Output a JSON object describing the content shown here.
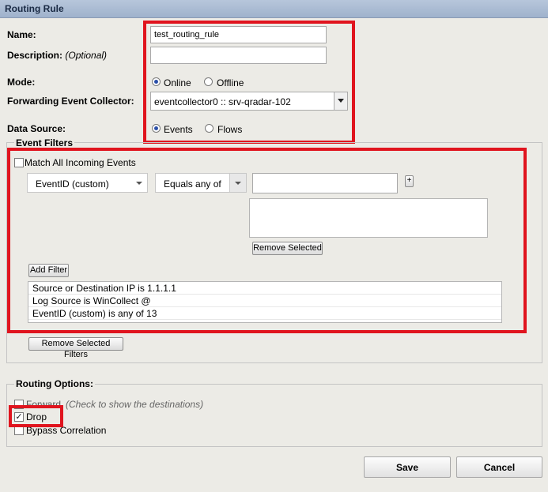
{
  "window": {
    "title": "Routing Rule"
  },
  "form": {
    "name_label": "Name:",
    "name_value": "test_routing_rule",
    "description_label": "Description:",
    "description_optional": "(Optional)",
    "description_value": "",
    "mode_label": "Mode:",
    "mode_online": "Online",
    "mode_offline": "Offline",
    "mode_selected": "Online",
    "collector_label": "Forwarding Event Collector:",
    "collector_value": "eventcollector0 :: srv-qradar-102",
    "datasource_label": "Data Source:",
    "datasource_events": "Events",
    "datasource_flows": "Flows",
    "datasource_selected": "Events"
  },
  "event_filters": {
    "legend": "Event Filters",
    "match_all_label": "Match All Incoming Events",
    "match_all_checked": false,
    "field_select": "EventID (custom)",
    "operator_select": "Equals any of",
    "value_input": "",
    "add_value_label": "+",
    "remove_selected_label": "Remove Selected",
    "add_filter_label": "Add Filter",
    "filters": [
      "Source or Destination IP is 1.1.1.1",
      "Log Source is WinCollect @",
      "EventID (custom) is any of 13"
    ],
    "remove_selected_filters_label": "Remove Selected Filters"
  },
  "routing_options": {
    "legend": "Routing Options:",
    "forward_label": "Forward",
    "forward_hint": "(Check to show the destinations)",
    "forward_checked": false,
    "drop_label": "Drop",
    "drop_checked": true,
    "bypass_label": "Bypass Correlation",
    "bypass_checked": false
  },
  "footer": {
    "save_label": "Save",
    "cancel_label": "Cancel"
  },
  "colors": {
    "highlight_red": "#e0141e",
    "title_bar": "#a9bad2",
    "background": "#ecebe6"
  }
}
